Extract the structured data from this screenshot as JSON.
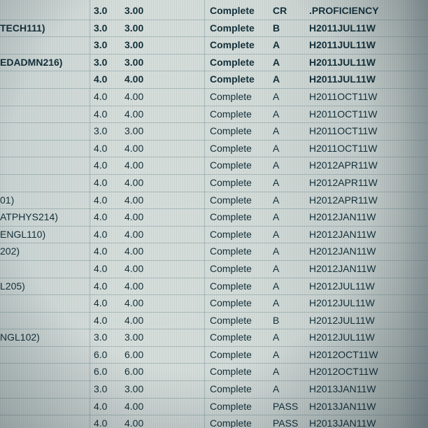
{
  "rows": [
    {
      "course": "",
      "attempted": "3.0",
      "earned": "3.00",
      "status": "Complete",
      "grade": "CR",
      "term": ".PROFICIENCY",
      "bold": true
    },
    {
      "course": "TECH111)",
      "attempted": "3.0",
      "earned": "3.00",
      "status": "Complete",
      "grade": "B",
      "term": "H2011JUL11W",
      "bold": true
    },
    {
      "course": "",
      "attempted": "3.0",
      "earned": "3.00",
      "status": "Complete",
      "grade": "A",
      "term": "H2011JUL11W",
      "bold": true
    },
    {
      "course": "EDADMN216)",
      "attempted": "3.0",
      "earned": "3.00",
      "status": "Complete",
      "grade": "A",
      "term": "H2011JUL11W",
      "bold": true
    },
    {
      "course": "",
      "attempted": "4.0",
      "earned": "4.00",
      "status": "Complete",
      "grade": "A",
      "term": "H2011JUL11W",
      "bold": true
    },
    {
      "course": "",
      "attempted": "4.0",
      "earned": "4.00",
      "status": "Complete",
      "grade": "A",
      "term": "H2011OCT11W",
      "bold": false
    },
    {
      "course": "",
      "attempted": "4.0",
      "earned": "4.00",
      "status": "Complete",
      "grade": "A",
      "term": "H2011OCT11W",
      "bold": false
    },
    {
      "course": "",
      "attempted": "3.0",
      "earned": "3.00",
      "status": "Complete",
      "grade": "A",
      "term": "H2011OCT11W",
      "bold": false
    },
    {
      "course": "",
      "attempted": "4.0",
      "earned": "4.00",
      "status": "Complete",
      "grade": "A",
      "term": "H2011OCT11W",
      "bold": false
    },
    {
      "course": "",
      "attempted": "4.0",
      "earned": "4.00",
      "status": "Complete",
      "grade": "A",
      "term": "H2012APR11W",
      "bold": false
    },
    {
      "course": "",
      "attempted": "4.0",
      "earned": "4.00",
      "status": "Complete",
      "grade": "A",
      "term": "H2012APR11W",
      "bold": false
    },
    {
      "course": "01)",
      "attempted": "4.0",
      "earned": "4.00",
      "status": "Complete",
      "grade": "A",
      "term": "H2012APR11W",
      "bold": false
    },
    {
      "course": "ATPHYS214)",
      "attempted": "4.0",
      "earned": "4.00",
      "status": "Complete",
      "grade": "A",
      "term": "H2012JAN11W",
      "bold": false
    },
    {
      "course": "ENGL110)",
      "attempted": "4.0",
      "earned": "4.00",
      "status": "Complete",
      "grade": "A",
      "term": "H2012JAN11W",
      "bold": false
    },
    {
      "course": "202)",
      "attempted": "4.0",
      "earned": "4.00",
      "status": "Complete",
      "grade": "A",
      "term": "H2012JAN11W",
      "bold": false
    },
    {
      "course": "",
      "attempted": "4.0",
      "earned": "4.00",
      "status": "Complete",
      "grade": "A",
      "term": "H2012JAN11W",
      "bold": false
    },
    {
      "course": "L205)",
      "attempted": "4.0",
      "earned": "4.00",
      "status": "Complete",
      "grade": "A",
      "term": "H2012JUL11W",
      "bold": false
    },
    {
      "course": "",
      "attempted": "4.0",
      "earned": "4.00",
      "status": "Complete",
      "grade": "A",
      "term": "H2012JUL11W",
      "bold": false
    },
    {
      "course": "",
      "attempted": "4.0",
      "earned": "4.00",
      "status": "Complete",
      "grade": "B",
      "term": "H2012JUL11W",
      "bold": false
    },
    {
      "course": "NGL102)",
      "attempted": "3.0",
      "earned": "3.00",
      "status": "Complete",
      "grade": "A",
      "term": "H2012JUL11W",
      "bold": false
    },
    {
      "course": "",
      "attempted": "6.0",
      "earned": "6.00",
      "status": "Complete",
      "grade": "A",
      "term": "H2012OCT11W",
      "bold": false
    },
    {
      "course": "",
      "attempted": "6.0",
      "earned": "6.00",
      "status": "Complete",
      "grade": "A",
      "term": "H2012OCT11W",
      "bold": false
    },
    {
      "course": "",
      "attempted": "3.0",
      "earned": "3.00",
      "status": "Complete",
      "grade": "A",
      "term": "H2013JAN11W",
      "bold": false
    },
    {
      "course": "",
      "attempted": "4.0",
      "earned": "4.00",
      "status": "Complete",
      "grade": "PASS",
      "term": "H2013JAN11W",
      "bold": false
    },
    {
      "course": "",
      "attempted": "4.0",
      "earned": "4.00",
      "status": "Complete",
      "grade": "PASS",
      "term": "H2013JAN11W",
      "bold": false
    }
  ]
}
